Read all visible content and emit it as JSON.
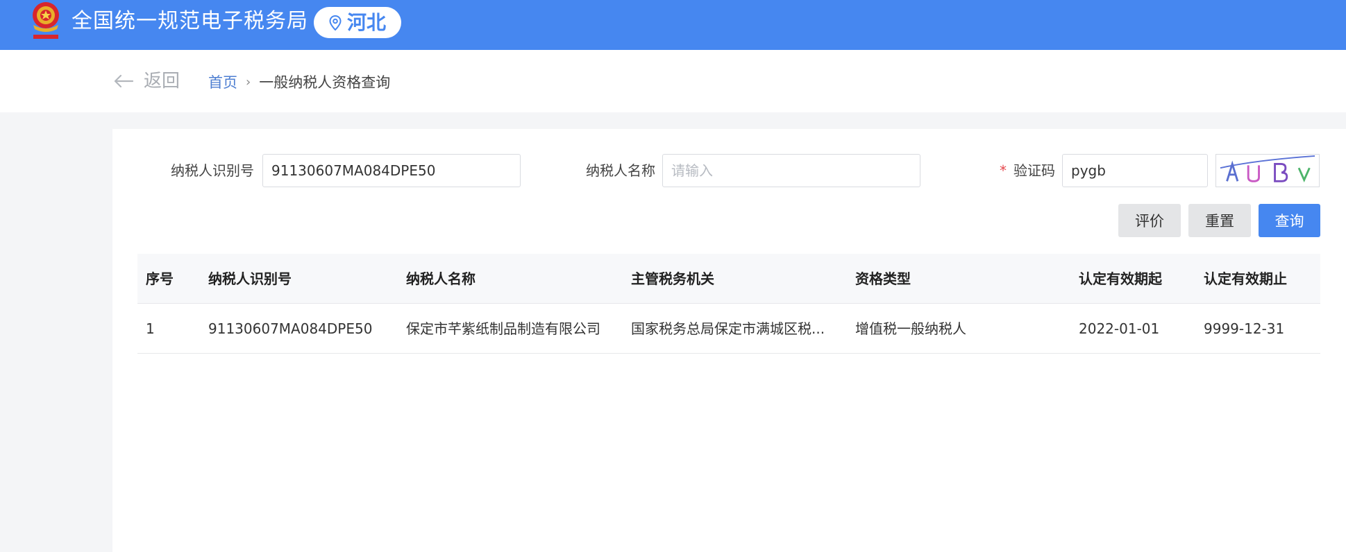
{
  "header": {
    "site_title": "全国统一规范电子税务局",
    "region": "河北",
    "emblem_icon": "tax-emblem-icon",
    "colors": {
      "primary": "#4687f0",
      "emblem_red": "#d8262c",
      "emblem_gold": "#e8b02a"
    }
  },
  "nav": {
    "back_label": "返回",
    "breadcrumb": {
      "home": "首页",
      "separator": "›",
      "current": "一般纳税人资格查询"
    }
  },
  "form": {
    "taxpayer_id": {
      "label": "纳税人识别号",
      "value": "91130607MA084DPE50"
    },
    "taxpayer_name": {
      "label": "纳税人名称",
      "value": "",
      "placeholder": "请输入"
    },
    "captcha": {
      "required_mark": "*",
      "label": "验证码",
      "value": "pygb"
    },
    "buttons": {
      "evaluate": "评价",
      "reset": "重置",
      "query": "查询"
    }
  },
  "table": {
    "columns": [
      "序号",
      "纳税人识别号",
      "纳税人名称",
      "主管税务机关",
      "资格类型",
      "认定有效期起",
      "认定有效期止"
    ],
    "rows": [
      [
        "1",
        "91130607MA084DPE50",
        "保定市芊紫纸制品制造有限公司",
        "国家税务总局保定市满城区税...",
        "增值税一般纳税人",
        "2022-01-01",
        "9999-12-31"
      ]
    ]
  }
}
